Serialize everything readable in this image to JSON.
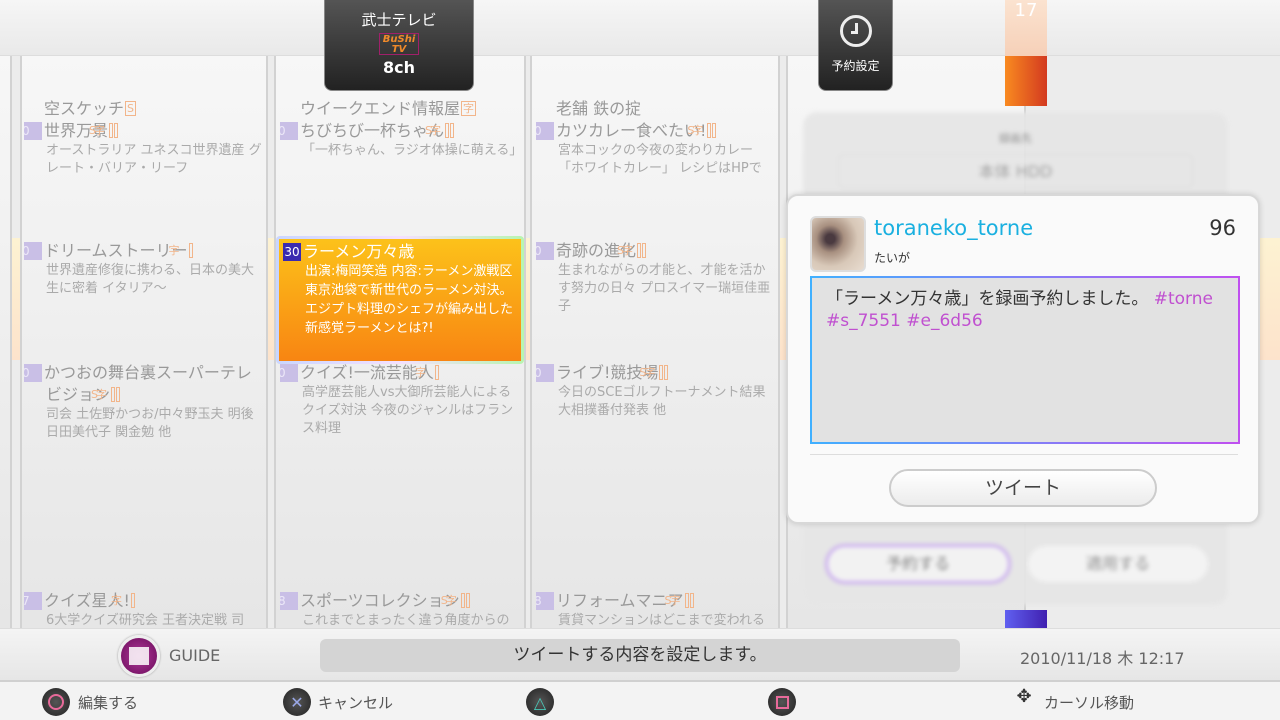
{
  "header": {
    "channel_name": "武士テレビ",
    "channel_logo": "BuShi TV",
    "channel_number": "8ch",
    "reserve_tab": "予約設定",
    "hour": "17"
  },
  "columns": [
    {
      "prev": "空スケッチ",
      "prev_badges": [
        "S"
      ],
      "programs": [
        {
          "min": "00",
          "title": "世界万景",
          "badges": [
            "S",
            "字"
          ],
          "desc": "オーストラリア ユネスコ世界遺産 グレート・バリア・リーフ"
        },
        {
          "min": "30",
          "title": "ドリームストーリー",
          "badges": [
            "字"
          ],
          "desc": "世界遺産修復に携わる、日本の美大生に密着 イタリア〜"
        },
        {
          "min": "00",
          "title": "かつおの舞台裏スーパーテレビジョン",
          "badges": [
            "S",
            "字"
          ],
          "desc": "司会 土佐野かつお/中々野玉夫 明後日田美代子 関金勉 他"
        },
        {
          "min": "57",
          "title": "クイズ星人!",
          "badges": [
            "字"
          ],
          "desc": "6大学クイズ研究会 王者決定戦 司"
        }
      ]
    },
    {
      "prev": "ウイークエンド情報屋",
      "prev_badges": [
        "字"
      ],
      "programs": [
        {
          "min": "00",
          "title": "ちびちび一杯ちゃん",
          "badges": [
            "S",
            "字"
          ],
          "desc": "「一杯ちゃん、ラジオ体操に萌える」"
        },
        {
          "min": "30",
          "title": "ラーメン万々歳",
          "badges": [],
          "desc": "出演:梅岡笑造 内容:ラーメン激戦区東京池袋で新世代のラーメン対決。エジプト料理のシェフが編み出した新感覚ラーメンとは?!"
        },
        {
          "min": "00",
          "title": "クイズ!一流芸能人",
          "badges": [
            "字"
          ],
          "desc": "高学歴芸能人vs大御所芸能人によるクイズ対決 今夜のジャンルはフランス料理"
        },
        {
          "min": "58",
          "title": "スポーツコレクション",
          "badges": [
            "S",
            "字"
          ],
          "desc": "これまでとまったく違う角度からの"
        }
      ]
    },
    {
      "prev": "老舗 鉄の掟",
      "prev_badges": [],
      "programs": [
        {
          "min": "00",
          "title": "カツカレー食べたい!",
          "badges": [
            "S",
            "字"
          ],
          "desc": "宮本コックの今夜の変わりカレー「ホワイトカレー」 レシピはHPで"
        },
        {
          "min": "30",
          "title": "奇跡の進化",
          "badges": [
            "S",
            "字"
          ],
          "desc": "生まれながらの才能と、才能を活かす努力の日々 プロスイマー瑞垣佳亜子"
        },
        {
          "min": "00",
          "title": "ライブ!競技場",
          "badges": [
            "S",
            "字"
          ],
          "desc": "今日のSCEゴルフトーナメント結果 大相撲番付発表 他"
        },
        {
          "min": "58",
          "title": "リフォームマニア",
          "badges": [
            "S",
            "字"
          ],
          "desc": "賃貸マンションはどこまで変われる"
        }
      ]
    }
  ],
  "reserve_panel": {
    "dest_label": "録画先",
    "dest_value": "本体 HDD",
    "reserve_button": "予約する",
    "apply_button": "適用する"
  },
  "tweet": {
    "username": "toraneko_torne",
    "display_name": "たいが",
    "char_count": "96",
    "text": "「ラーメン万々歳」を録画予約しました。",
    "hashtags": "#torne #s_7551 #e_6d56",
    "tweet_button": "ツイート"
  },
  "footer": {
    "guide_label": "GUIDE",
    "status": "ツイートする内容を設定します。",
    "datetime": "2010/11/18 木 12:17"
  },
  "hints": [
    {
      "icon": "circle",
      "label": "編集する"
    },
    {
      "icon": "cross",
      "label": "キャンセル"
    },
    {
      "icon": "triangle",
      "label": ""
    },
    {
      "icon": "square",
      "label": ""
    },
    {
      "icon": "dpad",
      "label": "カーソル移動"
    }
  ],
  "colors": {
    "selected": "#f88512",
    "username": "#1ab0e0",
    "hashtag": "#c050d0",
    "guide": "#8a1a7a"
  }
}
